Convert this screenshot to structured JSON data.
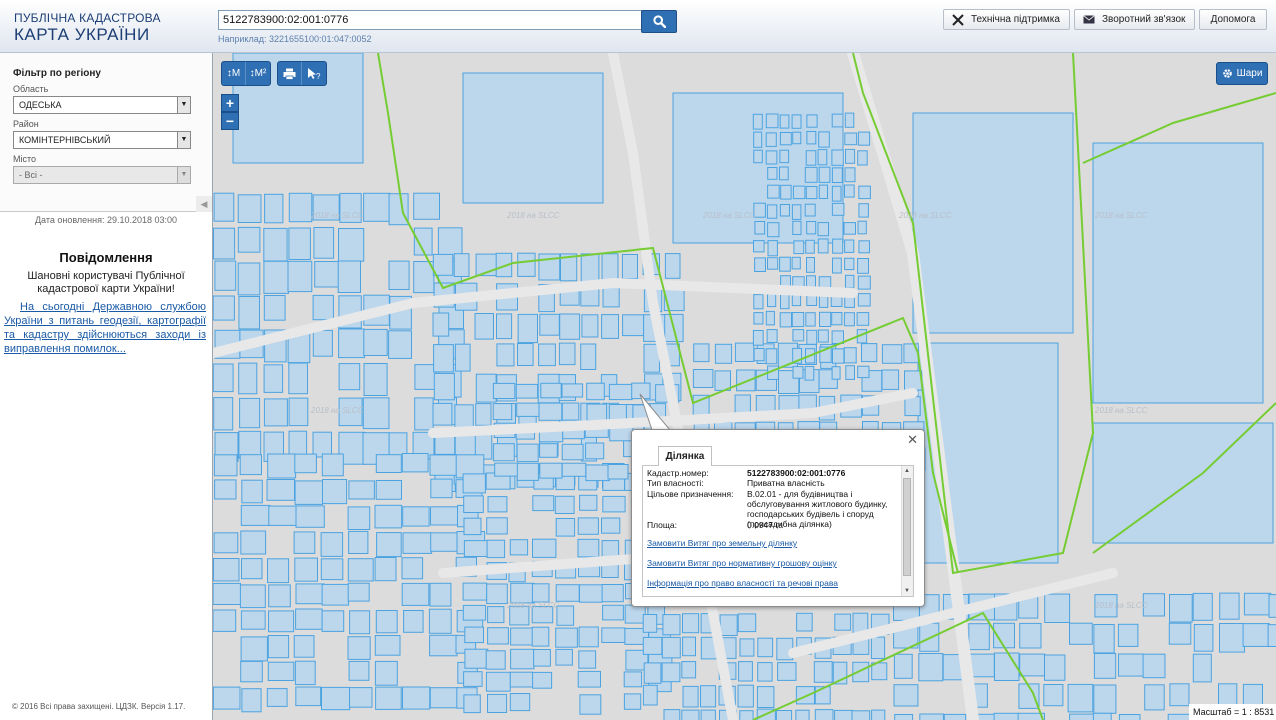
{
  "header": {
    "logo_line1": "ПУБЛІЧНА КАДАСТРОВА",
    "logo_line2": "КАРТА УКРАЇНИ",
    "search_value": "5122783900:02:001:0776",
    "example_text": "Наприклад: 3221655100:01:047:0052",
    "buttons": {
      "support": "Технічна підтримка",
      "feedback": "Зворотний зв'язок",
      "help": "Допомога"
    }
  },
  "sidebar": {
    "filter_title": "Фільтр по регіону",
    "region_label": "Область",
    "region_value": "ОДЕСЬКА",
    "district_label": "Район",
    "district_value": "КОМІНТЕРНІВСЬКИЙ",
    "city_label": "Місто",
    "city_value": "- Всі -",
    "update_text": "Дата оновлення: 29.10.2018 03:00",
    "notification_title": "Повідомлення",
    "notification_greeting": "Шановні користувачі Публічної кадастрової карти України!",
    "notification_link": "На сьогодні Державною службою України з питань геодезії, картографії та кадастру здійснюються заходи із виправлення помилок...",
    "copyright": "© 2016 Всі права захищені. ЦДЗК. Версія 1.17."
  },
  "map": {
    "tools": [
      "↕М",
      "↕М²",
      "print-icon",
      "info-cursor-icon"
    ],
    "zoom_in": "+",
    "zoom_out": "−",
    "layers_label": "Шари",
    "scale_text": "Масштаб = 1 : 8531",
    "watermark": "2018 на SLCC",
    "colors": {
      "parcel_fill": "#bcd6ec",
      "parcel_stroke": "#4da3e0",
      "boundary": "#76cc33",
      "accent": "#2f6fb3"
    }
  },
  "popup": {
    "tab_label": "Ділянка",
    "rows": [
      {
        "key": "Кадастр.номер:",
        "value": "5122783900:02:001:0776"
      },
      {
        "key": "Тип власності:",
        "value": "Приватна власність"
      },
      {
        "key": "Цільове призначення:",
        "value": "В.02.01 - для будівництва і обслуговування житлового будинку, господарських будівель і споруд (присадибна ділянка)"
      },
      {
        "key": "Площа:",
        "value": "0.0947 га"
      }
    ],
    "links": [
      "Замовити Витяг про земельну ділянку",
      "Замовити Витяг про нормативну грошову оцінку",
      "Інформація про право власності та речові права"
    ]
  }
}
